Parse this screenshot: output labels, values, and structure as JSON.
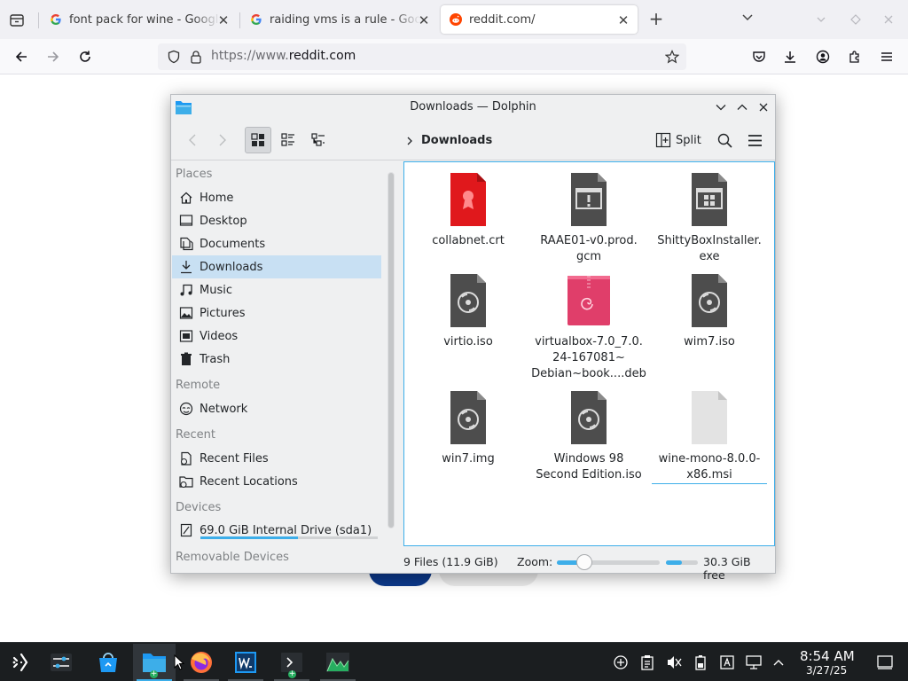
{
  "browser": {
    "tabs": [
      {
        "title": "font pack for wine - Google Search",
        "favicon": "google-icon"
      },
      {
        "title": "raiding vms is a rule - Google Search",
        "favicon": "google-icon"
      },
      {
        "title": "reddit.com/",
        "favicon": "reddit-icon"
      }
    ],
    "url_prefix": "https://www.",
    "url_domain": "reddit.com",
    "accent": "#ff4500"
  },
  "dolphin": {
    "title": "Downloads — Dolphin",
    "breadcrumb": "Downloads",
    "split_label": "Split",
    "places": {
      "sections": {
        "places": "Places",
        "remote": "Remote",
        "recent": "Recent",
        "devices": "Devices",
        "removable": "Removable Devices"
      },
      "items": [
        {
          "label": "Home",
          "icon": "home-icon"
        },
        {
          "label": "Desktop",
          "icon": "desktop-icon"
        },
        {
          "label": "Documents",
          "icon": "documents-icon"
        },
        {
          "label": "Downloads",
          "icon": "downloads-icon",
          "selected": true
        },
        {
          "label": "Music",
          "icon": "music-icon"
        },
        {
          "label": "Pictures",
          "icon": "pictures-icon"
        },
        {
          "label": "Videos",
          "icon": "videos-icon"
        },
        {
          "label": "Trash",
          "icon": "trash-icon"
        }
      ],
      "remote_items": [
        {
          "label": "Network",
          "icon": "network-icon"
        }
      ],
      "recent_items": [
        {
          "label": "Recent Files",
          "icon": "recent-files-icon"
        },
        {
          "label": "Recent Locations",
          "icon": "recent-locations-icon"
        }
      ],
      "device_items": [
        {
          "label": "69.0 GiB Internal Drive (sda1)",
          "icon": "drive-icon",
          "usage_fraction": 0.55
        }
      ]
    },
    "files": [
      {
        "name1": "collabnet.crt",
        "name2": "",
        "name3": "",
        "type": "certificate"
      },
      {
        "name1": "RAAE01-v0.prod.",
        "name2": "gcm",
        "name3": "",
        "type": "unknown"
      },
      {
        "name1": "ShittyBoxInstaller.",
        "name2": "exe",
        "name3": "",
        "type": "exe"
      },
      {
        "name1": "virtio.iso",
        "name2": "",
        "name3": "",
        "type": "disc"
      },
      {
        "name1": "virtualbox-7.0_7.0.",
        "name2": "24-167081~",
        "name3": "Debian~book....deb",
        "type": "deb"
      },
      {
        "name1": "wim7.iso",
        "name2": "",
        "name3": "",
        "type": "disc"
      },
      {
        "name1": "win7.img",
        "name2": "",
        "name3": "",
        "type": "disc"
      },
      {
        "name1": "Windows 98",
        "name2": "Second Edition.iso",
        "name3": "",
        "type": "disc"
      },
      {
        "name1": "wine-mono-8.0.0-",
        "name2": "x86.msi",
        "name3": "",
        "type": "blank"
      }
    ],
    "status": {
      "count": "9 Files (11.9 GiB)",
      "zoom_label": "Zoom:",
      "zoom_fraction": 0.27,
      "free": "30.3 GiB free",
      "free_fraction": 0.5
    }
  },
  "taskbar": {
    "time": "8:54 AM",
    "date": "3/27/25",
    "accent": "#3daee9"
  }
}
